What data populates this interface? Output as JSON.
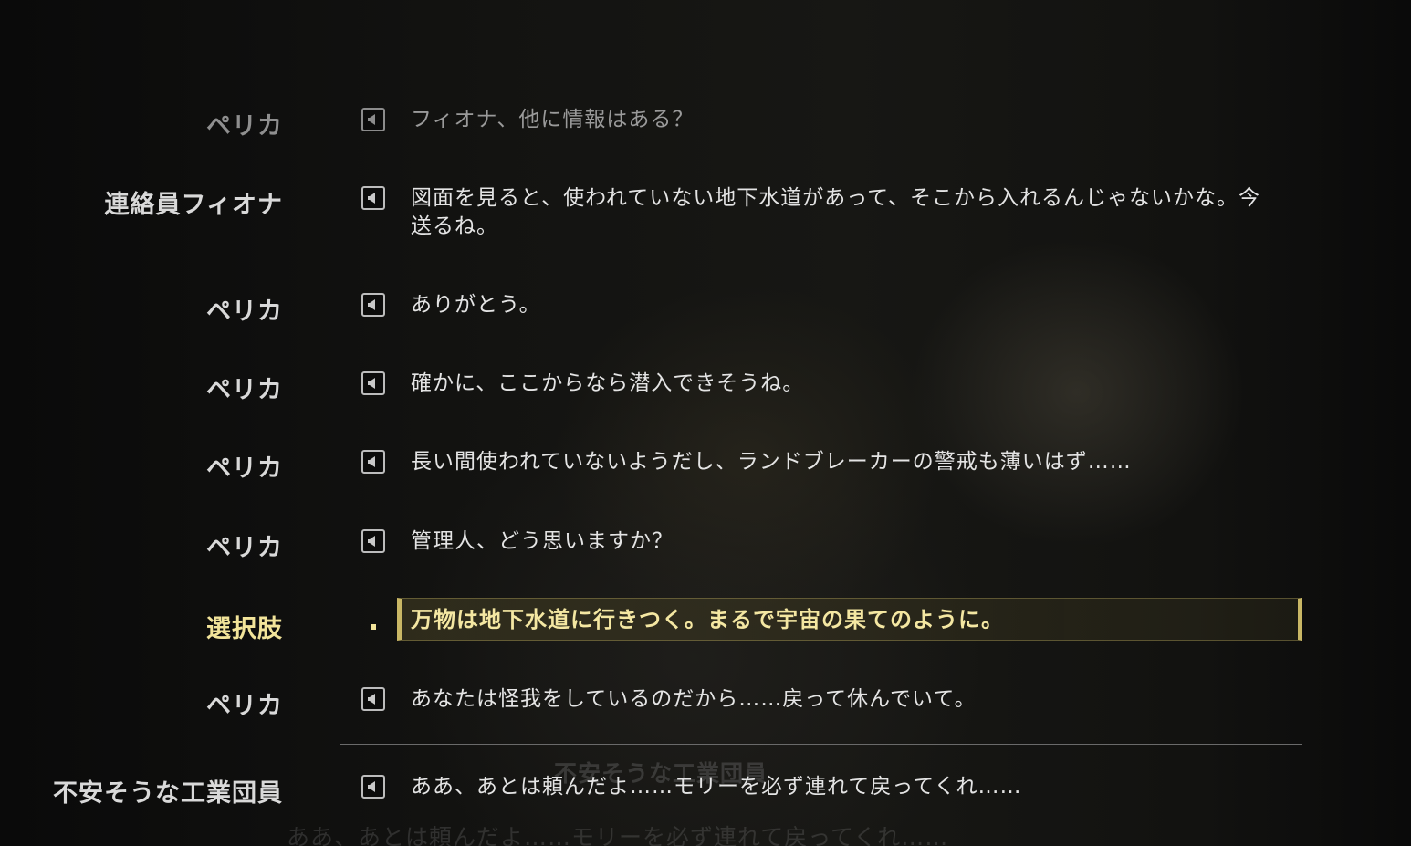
{
  "dialogue_log": [
    {
      "speaker": "ペリカ",
      "line": "フィオナ、他に情報はある？"
    },
    {
      "speaker": "連絡員フィオナ",
      "line": "図面を見ると、使われていない地下水道があって、そこから入れるんじゃないかな。今送るね。"
    },
    {
      "speaker": "ペリカ",
      "line": "ありがとう。"
    },
    {
      "speaker": "ペリカ",
      "line": "確かに、ここからなら潜入できそうね。"
    },
    {
      "speaker": "ペリカ",
      "line": "長い間使われていないようだし、ランドブレーカーの警戒も薄いはず……"
    },
    {
      "speaker": "ペリカ",
      "line": "管理人、どう思いますか？"
    }
  ],
  "choice": {
    "label": "選択肢",
    "text": "万物は地下水道に行きつく。まるで宇宙の果てのように。"
  },
  "after_choice": [
    {
      "speaker": "ペリカ",
      "line": "あなたは怪我をしているのだから……戻って休んでいて。"
    }
  ],
  "current": {
    "speaker": "不安そうな工業団員",
    "line": "ああ、あとは頼んだよ……モリーを必ず連れて戻ってくれ……"
  },
  "background_subtitle": {
    "speaker": "不安そうな工業団員",
    "line": "ああ、あとは頼んだよ……モリーを必ず連れて戻ってくれ……"
  },
  "icons": {
    "voice": "speaker-play-icon",
    "choice_marker": "bullet-square-icon"
  },
  "colors": {
    "speaker_text": "#d9d9d9",
    "choice_gold": "#f2e49a",
    "choice_border": "#c9b765"
  }
}
